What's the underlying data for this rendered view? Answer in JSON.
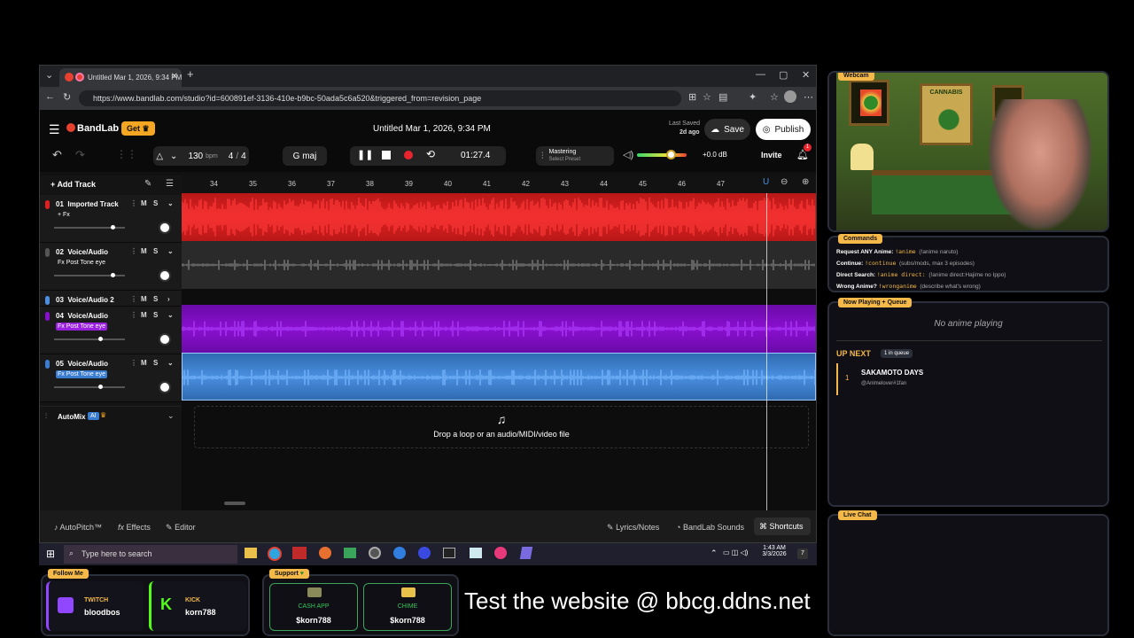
{
  "browser": {
    "tab_title": "Untitled Mar 1, 2026, 9:34 PM",
    "url": "https://www.bandlab.com/studio?id=600891ef-3136-410e-b9bc-50ada5c6a520&triggered_from=revision_page",
    "min": "—",
    "max": "▢",
    "close": "✕"
  },
  "app": {
    "logo": "BandLab",
    "get_label": "Get",
    "project_title": "Untitled Mar 1, 2026, 9:34 PM",
    "last_saved_label": "Last Saved",
    "last_saved_value": "2d ago",
    "save_label": "Save",
    "publish_label": "Publish",
    "bpm": "130",
    "bpm_unit": "bpm",
    "time_sig_top": "4",
    "time_sig_bottom": "4",
    "key": "G maj",
    "time": "01:27.4",
    "mastering_label": "Mastering",
    "mastering_sub": "Select Preset",
    "db": "+0.0 dB",
    "invite_label": "Invite",
    "notif_count": "1",
    "add_track_label": "Add Track",
    "ruler": [
      "34",
      "35",
      "36",
      "37",
      "38",
      "39",
      "40",
      "41",
      "42",
      "43",
      "44",
      "45",
      "46",
      "47"
    ],
    "tracks": [
      {
        "num": "01",
        "name": "Imported Track",
        "fx": "+ Fx",
        "color": "#e02020",
        "vol": 0.82
      },
      {
        "num": "02",
        "name": "Voice/Audio",
        "fx": "Fx Post Tone eye",
        "color": "#555555",
        "vol": 0.82
      },
      {
        "num": "03",
        "name": "Voice/Audio 2",
        "fx": "",
        "color": "#4a8fe0",
        "vol": 0.0
      },
      {
        "num": "04",
        "name": "Voice/Audio",
        "fx": "Fx Post Tone eye",
        "color": "#8a10d0",
        "vol": 0.65
      },
      {
        "num": "05",
        "name": "Voice/Audio",
        "fx": "Fx Post Tone eye",
        "color": "#3a7cd0",
        "vol": 0.65
      }
    ],
    "mute": "M",
    "solo": "S",
    "automix_label": "AutoMix",
    "ai_badge": "AI",
    "drop_text": "Drop a loop or an audio/MIDI/video file",
    "bottom": {
      "autopitch": "AutoPitch™",
      "effects": "Effects",
      "fx_prefix": "fx",
      "editor": "Editor",
      "lyrics": "Lyrics/Notes",
      "sounds": "BandLab Sounds",
      "shortcuts": "Shortcuts"
    }
  },
  "taskbar": {
    "search_placeholder": "Type here to search",
    "time": "1:43 AM",
    "date": "3/3/2026",
    "notif": "7"
  },
  "overlay": {
    "webcam_tag": "Webcam",
    "commands_tag": "Commands",
    "commands": [
      {
        "label": "Request ANY Anime:",
        "cmd": "!anime",
        "desc": "(!anime naruto)"
      },
      {
        "label": "Continue:",
        "cmd": "!continue",
        "desc": "(subs/mods, max 3 episodes)"
      },
      {
        "label": "Direct Search:",
        "cmd": "!anime direct:",
        "desc": "(!anime direct:Hajime no Ippo)"
      },
      {
        "label": "Wrong Anime?",
        "cmd": "!wronganime",
        "desc": "(describe what's wrong)"
      }
    ],
    "nowplaying_tag": "Now Playing + Queue",
    "no_anime": "No anime playing",
    "up_next": "UP NEXT",
    "queue_count": "1 in queue",
    "queue": [
      {
        "pos": "1",
        "title": "SAKAMOTO DAYS",
        "user": "@Animelover#1fan"
      }
    ],
    "livechat_tag": "Live Chat",
    "follow_tag": "Follow Me",
    "twitch_label": "TWITCH",
    "twitch_user": "bloodbos",
    "kick_label": "KICK",
    "kick_user": "korn788",
    "support_tag": "Support",
    "cashapp_label": "CASH APP",
    "cashapp_user": "$korn788",
    "chime_label": "CHIME",
    "chime_user": "$korn788",
    "website": "Test the website @ bbcg.ddns.net",
    "poster1": "CANNABIS"
  }
}
